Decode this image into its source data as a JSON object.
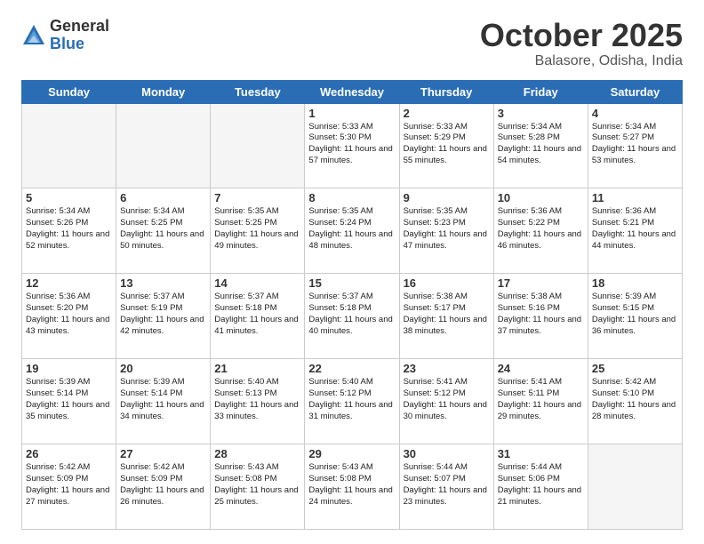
{
  "header": {
    "logo_general": "General",
    "logo_blue": "Blue",
    "month": "October 2025",
    "location": "Balasore, Odisha, India"
  },
  "days_of_week": [
    "Sunday",
    "Monday",
    "Tuesday",
    "Wednesday",
    "Thursday",
    "Friday",
    "Saturday"
  ],
  "weeks": [
    [
      {
        "day": "",
        "text": ""
      },
      {
        "day": "",
        "text": ""
      },
      {
        "day": "",
        "text": ""
      },
      {
        "day": "1",
        "text": "Sunrise: 5:33 AM\nSunset: 5:30 PM\nDaylight: 11 hours and 57 minutes."
      },
      {
        "day": "2",
        "text": "Sunrise: 5:33 AM\nSunset: 5:29 PM\nDaylight: 11 hours and 55 minutes."
      },
      {
        "day": "3",
        "text": "Sunrise: 5:34 AM\nSunset: 5:28 PM\nDaylight: 11 hours and 54 minutes."
      },
      {
        "day": "4",
        "text": "Sunrise: 5:34 AM\nSunset: 5:27 PM\nDaylight: 11 hours and 53 minutes."
      }
    ],
    [
      {
        "day": "5",
        "text": "Sunrise: 5:34 AM\nSunset: 5:26 PM\nDaylight: 11 hours and 52 minutes."
      },
      {
        "day": "6",
        "text": "Sunrise: 5:34 AM\nSunset: 5:25 PM\nDaylight: 11 hours and 50 minutes."
      },
      {
        "day": "7",
        "text": "Sunrise: 5:35 AM\nSunset: 5:25 PM\nDaylight: 11 hours and 49 minutes."
      },
      {
        "day": "8",
        "text": "Sunrise: 5:35 AM\nSunset: 5:24 PM\nDaylight: 11 hours and 48 minutes."
      },
      {
        "day": "9",
        "text": "Sunrise: 5:35 AM\nSunset: 5:23 PM\nDaylight: 11 hours and 47 minutes."
      },
      {
        "day": "10",
        "text": "Sunrise: 5:36 AM\nSunset: 5:22 PM\nDaylight: 11 hours and 46 minutes."
      },
      {
        "day": "11",
        "text": "Sunrise: 5:36 AM\nSunset: 5:21 PM\nDaylight: 11 hours and 44 minutes."
      }
    ],
    [
      {
        "day": "12",
        "text": "Sunrise: 5:36 AM\nSunset: 5:20 PM\nDaylight: 11 hours and 43 minutes."
      },
      {
        "day": "13",
        "text": "Sunrise: 5:37 AM\nSunset: 5:19 PM\nDaylight: 11 hours and 42 minutes."
      },
      {
        "day": "14",
        "text": "Sunrise: 5:37 AM\nSunset: 5:18 PM\nDaylight: 11 hours and 41 minutes."
      },
      {
        "day": "15",
        "text": "Sunrise: 5:37 AM\nSunset: 5:18 PM\nDaylight: 11 hours and 40 minutes."
      },
      {
        "day": "16",
        "text": "Sunrise: 5:38 AM\nSunset: 5:17 PM\nDaylight: 11 hours and 38 minutes."
      },
      {
        "day": "17",
        "text": "Sunrise: 5:38 AM\nSunset: 5:16 PM\nDaylight: 11 hours and 37 minutes."
      },
      {
        "day": "18",
        "text": "Sunrise: 5:39 AM\nSunset: 5:15 PM\nDaylight: 11 hours and 36 minutes."
      }
    ],
    [
      {
        "day": "19",
        "text": "Sunrise: 5:39 AM\nSunset: 5:14 PM\nDaylight: 11 hours and 35 minutes."
      },
      {
        "day": "20",
        "text": "Sunrise: 5:39 AM\nSunset: 5:14 PM\nDaylight: 11 hours and 34 minutes."
      },
      {
        "day": "21",
        "text": "Sunrise: 5:40 AM\nSunset: 5:13 PM\nDaylight: 11 hours and 33 minutes."
      },
      {
        "day": "22",
        "text": "Sunrise: 5:40 AM\nSunset: 5:12 PM\nDaylight: 11 hours and 31 minutes."
      },
      {
        "day": "23",
        "text": "Sunrise: 5:41 AM\nSunset: 5:12 PM\nDaylight: 11 hours and 30 minutes."
      },
      {
        "day": "24",
        "text": "Sunrise: 5:41 AM\nSunset: 5:11 PM\nDaylight: 11 hours and 29 minutes."
      },
      {
        "day": "25",
        "text": "Sunrise: 5:42 AM\nSunset: 5:10 PM\nDaylight: 11 hours and 28 minutes."
      }
    ],
    [
      {
        "day": "26",
        "text": "Sunrise: 5:42 AM\nSunset: 5:09 PM\nDaylight: 11 hours and 27 minutes."
      },
      {
        "day": "27",
        "text": "Sunrise: 5:42 AM\nSunset: 5:09 PM\nDaylight: 11 hours and 26 minutes."
      },
      {
        "day": "28",
        "text": "Sunrise: 5:43 AM\nSunset: 5:08 PM\nDaylight: 11 hours and 25 minutes."
      },
      {
        "day": "29",
        "text": "Sunrise: 5:43 AM\nSunset: 5:08 PM\nDaylight: 11 hours and 24 minutes."
      },
      {
        "day": "30",
        "text": "Sunrise: 5:44 AM\nSunset: 5:07 PM\nDaylight: 11 hours and 23 minutes."
      },
      {
        "day": "31",
        "text": "Sunrise: 5:44 AM\nSunset: 5:06 PM\nDaylight: 11 hours and 21 minutes."
      },
      {
        "day": "",
        "text": ""
      }
    ]
  ]
}
